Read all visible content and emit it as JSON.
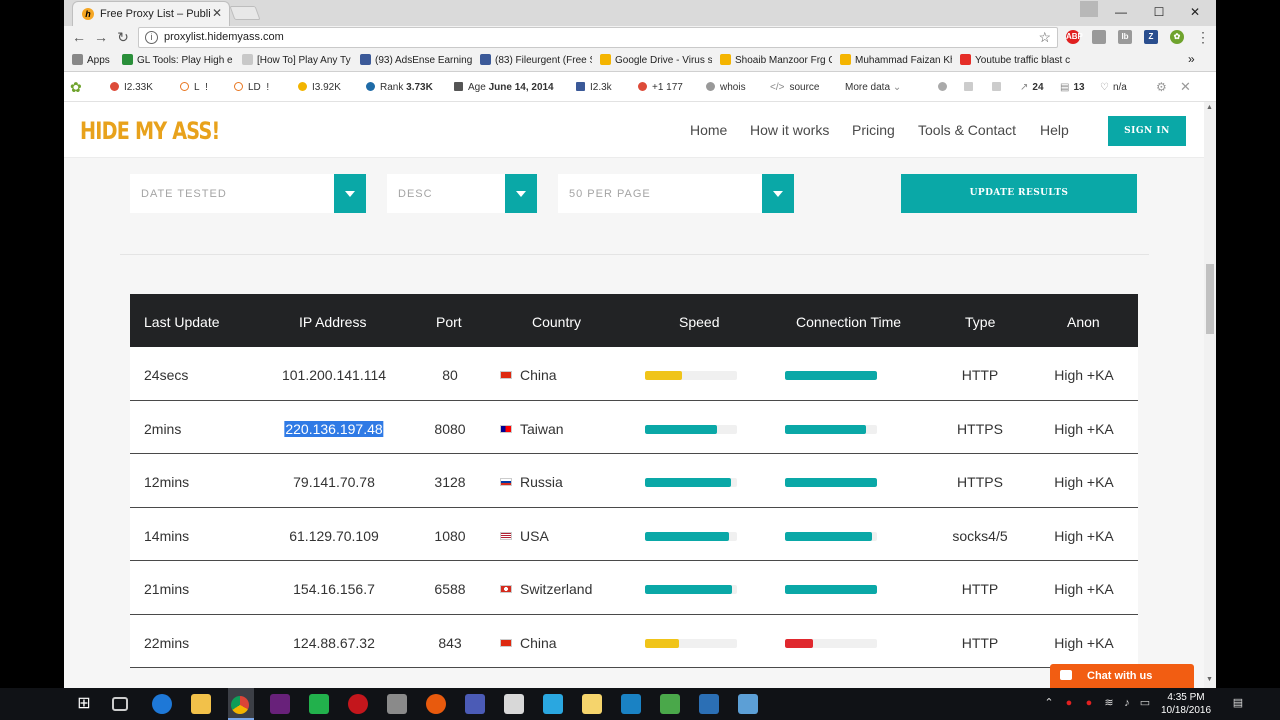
{
  "browser": {
    "tab_title": "Free Proxy List – Public P",
    "tab_close": "✕",
    "url": "proxylist.hidemyass.com",
    "window_controls": [
      "—",
      "☐",
      "✕"
    ],
    "bookmarks": [
      {
        "label": "Apps",
        "color": "#888888"
      },
      {
        "label": "GL Tools: Play High e",
        "color": "#2a8f3a"
      },
      {
        "label": "[How To] Play Any Ty",
        "color": "#c8c8c8"
      },
      {
        "label": "(93) AdsEnse Earning",
        "color": "#3b5998"
      },
      {
        "label": "(83) Fileurgent (Free S",
        "color": "#3b5998"
      },
      {
        "label": "Google Drive - Virus s",
        "color": "#f4b400"
      },
      {
        "label": "Shoaib Manzoor Frg C",
        "color": "#f4b400"
      },
      {
        "label": "Muhammad Faizan Kh",
        "color": "#f4b400"
      },
      {
        "label": "Youtube traffic blast c",
        "color": "#e52d27"
      }
    ],
    "bookmarks_overflow": "»",
    "seo_bar": [
      {
        "label": "",
        "value": "I2.33K",
        "icon": "google-icon",
        "color": "#dd4b39"
      },
      {
        "label": "L",
        "value": "!",
        "icon": "circle-icon",
        "color": "#e87722"
      },
      {
        "label": "LD",
        "value": "!",
        "icon": "circle-icon",
        "color": "#e87722"
      },
      {
        "label": "",
        "value": "I3.92K",
        "icon": "bing-icon",
        "color": "#f2b400"
      },
      {
        "label": "Rank",
        "value": "3.73K",
        "icon": "alexa-icon",
        "color": "#1f6ba7"
      },
      {
        "label": "Age",
        "value": "June 14, 2014",
        "icon": "calendar-icon",
        "color": "#555555"
      },
      {
        "label": "",
        "value": "I2.3k",
        "icon": "facebook-icon",
        "color": "#3b5998"
      },
      {
        "label": "",
        "value": "+1 177",
        "icon": "gplus-icon",
        "color": "#dd4b39"
      },
      {
        "label": "",
        "value": "whois",
        "icon": "person-icon",
        "color": "#777777"
      },
      {
        "label": "",
        "value": "source",
        "icon": "code-icon",
        "color": "#777777"
      },
      {
        "label": "",
        "value": "More data",
        "icon": "chevron-down-icon",
        "color": "#777777"
      },
      {
        "label": "",
        "value": "24",
        "icon": "external-link-icon",
        "color": "#777777"
      },
      {
        "label": "",
        "value": "13",
        "icon": "page-icon",
        "color": "#777777"
      },
      {
        "label": "",
        "value": "n/a",
        "icon": "heart-icon",
        "color": "#777777"
      }
    ]
  },
  "site": {
    "logo": "HIDE MY ASS!",
    "menu": [
      "Home",
      "How it works",
      "Pricing",
      "Tools & Contact",
      "Help"
    ],
    "signin": "SIGN IN",
    "accent": "#0aa8a7",
    "brand": "#e8a21c"
  },
  "filters": {
    "sort": "DATE TESTED",
    "order": "DESC",
    "per_page": "50 PER PAGE",
    "update": "UPDATE RESULTS"
  },
  "table": {
    "headers": [
      "Last Update",
      "IP Address",
      "Port",
      "Country",
      "Speed",
      "Connection Time",
      "Type",
      "Anon"
    ],
    "rows": [
      {
        "updated": "24secs",
        "ip": "101.200.141.114",
        "port": "80",
        "country": "China",
        "flag": "china-flag",
        "speed": 0.4,
        "speed_color": "#f0c419",
        "conn": 1.0,
        "conn_color": "#0aa8a7",
        "type": "HTTP",
        "anon": "High +KA"
      },
      {
        "updated": "2mins",
        "ip": "220.136.197.48",
        "port": "8080",
        "country": "Taiwan",
        "flag": "taiwan-flag",
        "speed": 0.78,
        "speed_color": "#0aa8a7",
        "conn": 0.88,
        "conn_color": "#0aa8a7",
        "type": "HTTPS",
        "anon": "High +KA",
        "selected": true
      },
      {
        "updated": "12mins",
        "ip": "79.141.70.78",
        "port": "3128",
        "country": "Russia",
        "flag": "russia-flag",
        "speed": 0.94,
        "speed_color": "#0aa8a7",
        "conn": 1.0,
        "conn_color": "#0aa8a7",
        "type": "HTTPS",
        "anon": "High +KA"
      },
      {
        "updated": "14mins",
        "ip": "61.129.70.109",
        "port": "1080",
        "country": "USA",
        "flag": "usa-flag",
        "speed": 0.91,
        "speed_color": "#0aa8a7",
        "conn": 0.95,
        "conn_color": "#0aa8a7",
        "type": "socks4/5",
        "anon": "High +KA"
      },
      {
        "updated": "21mins",
        "ip": "154.16.156.7",
        "port": "6588",
        "country": "Switzerland",
        "flag": "swiss-flag",
        "speed": 0.95,
        "speed_color": "#0aa8a7",
        "conn": 1.0,
        "conn_color": "#0aa8a7",
        "type": "HTTP",
        "anon": "High +KA"
      },
      {
        "updated": "22mins",
        "ip": "124.88.67.32",
        "port": "843",
        "country": "China",
        "flag": "china-flag",
        "speed": 0.37,
        "speed_color": "#f0c419",
        "conn": 0.3,
        "conn_color": "#e0282e",
        "type": "HTTP",
        "anon": "High +KA"
      }
    ]
  },
  "chat": {
    "label": "Chat with us",
    "color": "#f25d12"
  },
  "taskbar": {
    "time": "4:35 PM",
    "date": "10/18/2016"
  }
}
